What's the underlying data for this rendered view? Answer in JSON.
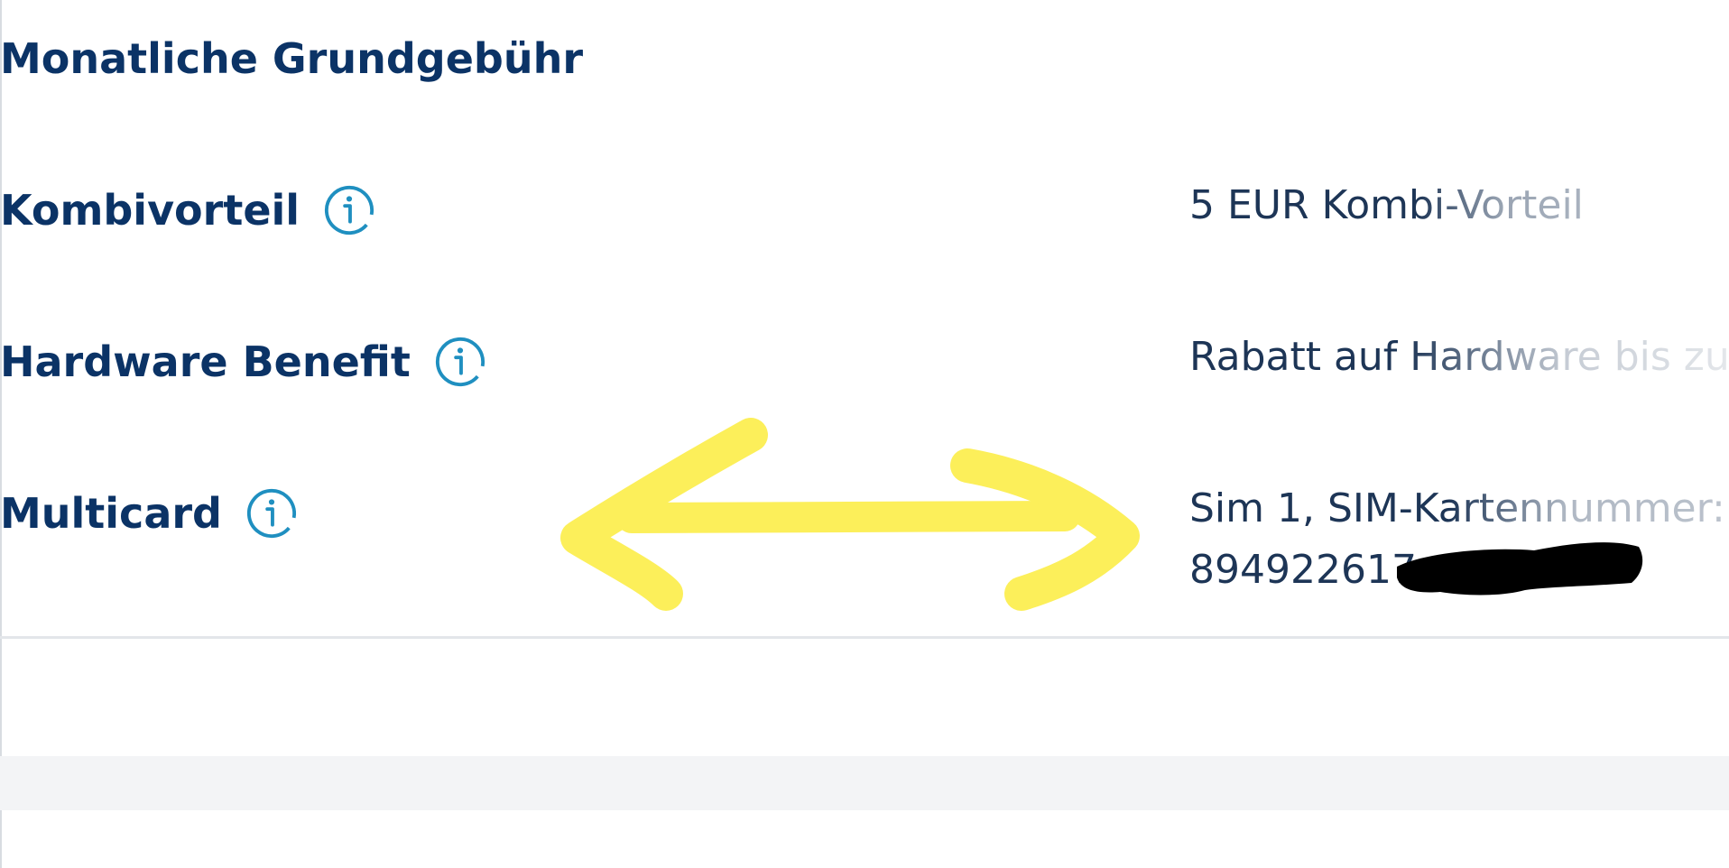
{
  "section": {
    "title": "Monatliche Grundgebühr"
  },
  "rows": [
    {
      "label": "Kombivorteil",
      "value": "5 EUR Kombi-Vorteil",
      "icon": "info-icon"
    },
    {
      "label": "Hardware Benefit",
      "value": "Rabatt auf Hardware bis zum",
      "icon": "info-icon"
    },
    {
      "label": "Multicard",
      "value_line1": "Sim 1, SIM-Kartennummer:",
      "value_line2": "894922617",
      "icon": "info-icon"
    }
  ],
  "colors": {
    "label": "#0b3366",
    "value": "#1d3556",
    "icon": "#1f8fc0",
    "annotation_arrow": "#fcef5a",
    "redaction": "#000000"
  }
}
